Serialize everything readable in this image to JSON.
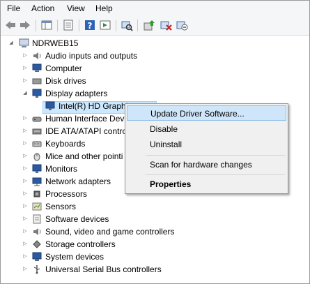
{
  "menu": [
    "File",
    "Action",
    "View",
    "Help"
  ],
  "toolbar": {
    "icons": [
      "back-icon",
      "forward-icon",
      "show-hide-tree-icon",
      "properties-icon",
      "help-icon",
      "action-pane-icon",
      "scan-hardware-icon",
      "update-driver-icon",
      "uninstall-device-icon",
      "disable-device-icon"
    ]
  },
  "tree": {
    "root": "NDRWEB15",
    "items": [
      {
        "label": "Audio inputs and outputs",
        "icon": "speaker-icon"
      },
      {
        "label": "Computer",
        "icon": "computer-icon"
      },
      {
        "label": "Disk drives",
        "icon": "disk-drive-icon"
      },
      {
        "label": "Display adapters",
        "icon": "display-adapter-icon",
        "expanded": true
      },
      {
        "label": "Intel(R) HD Graphi",
        "icon": "monitor-icon",
        "child": true,
        "selected": true
      },
      {
        "label": "Human Interface Devi",
        "icon": "hid-icon"
      },
      {
        "label": "IDE ATA/ATAPI contro",
        "icon": "ide-controller-icon"
      },
      {
        "label": "Keyboards",
        "icon": "keyboard-icon"
      },
      {
        "label": "Mice and other pointi",
        "icon": "mouse-icon"
      },
      {
        "label": "Monitors",
        "icon": "monitor-icon"
      },
      {
        "label": "Network adapters",
        "icon": "network-adapter-icon"
      },
      {
        "label": "Processors",
        "icon": "processor-icon"
      },
      {
        "label": "Sensors",
        "icon": "sensor-icon"
      },
      {
        "label": "Software devices",
        "icon": "software-device-icon"
      },
      {
        "label": "Sound, video and game controllers",
        "icon": "sound-icon"
      },
      {
        "label": "Storage controllers",
        "icon": "storage-controller-icon"
      },
      {
        "label": "System devices",
        "icon": "system-device-icon"
      },
      {
        "label": "Universal Serial Bus controllers",
        "icon": "usb-icon"
      }
    ]
  },
  "context_menu": {
    "update": "Update Driver Software...",
    "disable": "Disable",
    "uninstall": "Uninstall",
    "scan": "Scan for hardware changes",
    "properties": "Properties"
  },
  "colors": {
    "selection": "#cce8ff",
    "menu_highlight": "#cfe5f9",
    "bar": "#f5f6f7"
  }
}
